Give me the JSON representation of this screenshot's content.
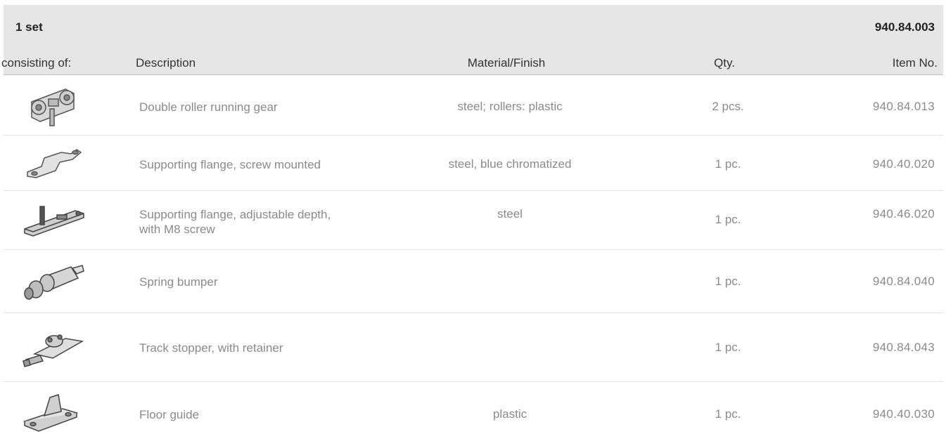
{
  "set": {
    "title": "1 set",
    "item_no": "940.84.003"
  },
  "columns": {
    "consisting": "consisting of:",
    "description": "Description",
    "material": "Material/Finish",
    "qty": "Qty.",
    "item_no": "Item No."
  },
  "rows": [
    {
      "icon": "running-gear-icon",
      "description": "Double roller running gear",
      "material": "steel; rollers: plastic",
      "qty": "2 pcs.",
      "item_no": "940.84.013"
    },
    {
      "icon": "supporting-flange-icon",
      "description": "Supporting flange, screw mounted",
      "material": "steel, blue chromatized",
      "qty": "1 pc.",
      "item_no": "940.40.020"
    },
    {
      "icon": "adjustable-flange-icon",
      "description": "Supporting flange, adjustable depth,",
      "description_line2": "with M8 screw",
      "material": "steel",
      "qty": "1 pc.",
      "item_no": "940.46.020"
    },
    {
      "icon": "spring-bumper-icon",
      "description": "Spring bumper",
      "material": "",
      "qty": "1 pc.",
      "item_no": "940.84.040"
    },
    {
      "icon": "track-stopper-icon",
      "description": "Track stopper, with retainer",
      "material": "",
      "qty": "1 pc.",
      "item_no": "940.84.043"
    },
    {
      "icon": "floor-guide-icon",
      "description": "Floor guide",
      "material": "plastic",
      "qty": "1 pc.",
      "item_no": "940.40.030"
    }
  ]
}
